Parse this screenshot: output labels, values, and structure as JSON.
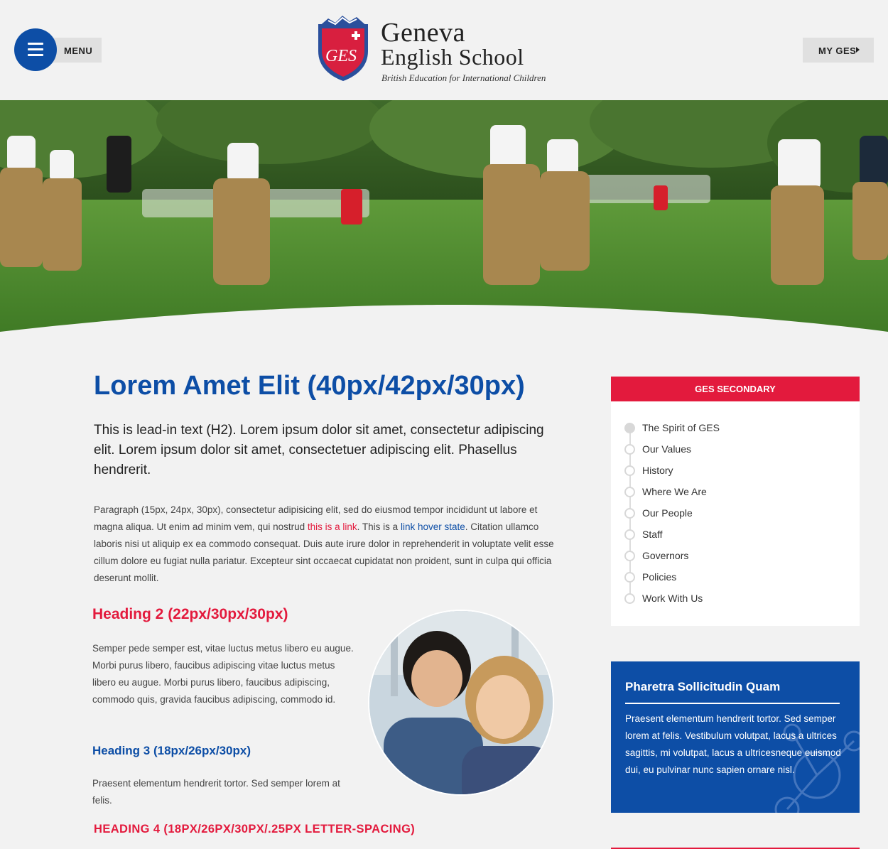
{
  "header": {
    "menu_label": "MENU",
    "logo": {
      "line1": "Geneva",
      "line2": "English School",
      "tagline": "British Education for International Children",
      "crest_text": "GES"
    },
    "myges_label": "MY GES"
  },
  "main": {
    "title": "Lorem Amet Elit (40px/42px/30px)",
    "lead": "This is lead-in text (H2). Lorem ipsum dolor sit amet, consectetur adipiscing elit. Lorem ipsum dolor sit amet, consectetuer adipiscing elit. Phasellus hendrerit.",
    "paragraph": {
      "before_link": "Paragraph (15px, 24px, 30px), consectetur adipisicing elit, sed do eiusmod tempor incididunt ut labore et magna aliqua. Ut enim ad minim vem, qui nostrud ",
      "link_text": "this is a link",
      "middle": ". This is a ",
      "hover_link_text": "link hover state",
      "after_link": ". Citation ullamco laboris nisi ut aliquip ex ea commodo consequat. Duis aute irure dolor in reprehenderit in voluptate velit esse cillum dolore eu fugiat nulla pariatur. Excepteur sint occaecat cupidatat non proident, sunt in culpa qui officia deserunt mollit."
    },
    "heading2": "Heading 2 (22px/30px/30px)",
    "paragraph2": "Semper pede semper est, vitae luctus metus libero eu augue. Morbi purus libero, faucibus adipiscing vitae luctus metus libero eu augue. Morbi purus libero, faucibus adipiscing, commodo quis, gravida faucibus adipiscing, commodo id.",
    "heading3": "Heading 3 (18px/26px/30px)",
    "paragraph3": "Praesent elementum hendrerit tortor. Sed semper lorem at felis.",
    "heading4": "HEADING 4 (18PX/26PX/30PX/.25PX LETTER-SPACING)"
  },
  "sidebar": {
    "nav_title": "GES SECONDARY",
    "nav_items": [
      {
        "label": "The Spirit of GES",
        "active": true
      },
      {
        "label": "Our Values"
      },
      {
        "label": "History"
      },
      {
        "label": "Where We Are"
      },
      {
        "label": "Our People"
      },
      {
        "label": "Staff"
      },
      {
        "label": "Governors"
      },
      {
        "label": "Policies"
      },
      {
        "label": "Work With Us"
      }
    ],
    "callout": {
      "title": "Pharetra Sollicitudin Quam",
      "text": "Praesent elementum hendrerit tortor. Sed semper lorem at felis. Vestibulum volutpat, lacus a ultrices sagittis, mi volutpat, lacus a ultricesneque euismod dui, eu pulvinar nunc sapien ornare nisl."
    }
  },
  "colors": {
    "brand_blue": "#0d4ea6",
    "brand_red": "#e31a3d",
    "background": "#f2f2f2"
  }
}
